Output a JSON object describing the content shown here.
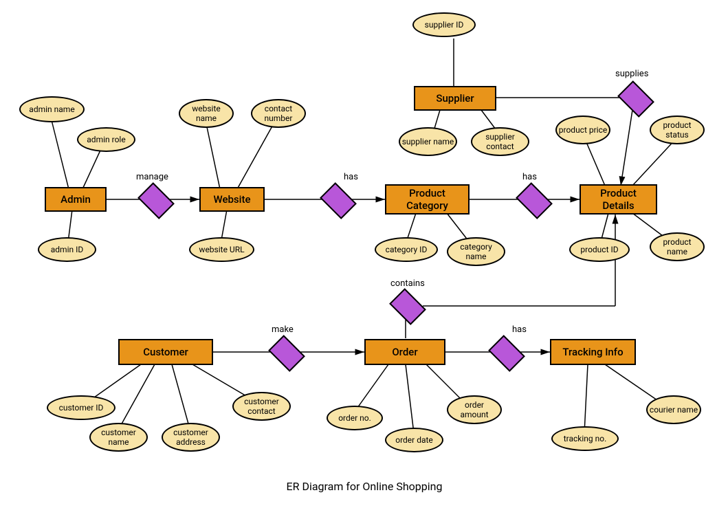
{
  "title": "ER Diagram for Online Shopping",
  "entities": {
    "admin": "Admin",
    "website": "Website",
    "productCategory": "Product Category",
    "productDetails": "Product Details",
    "supplier": "Supplier",
    "customer": "Customer",
    "order": "Order",
    "trackingInfo": "Tracking Info"
  },
  "attributes": {
    "adminName": "admin name",
    "adminRole": "admin role",
    "adminId": "admin ID",
    "websiteName": "website name",
    "contactNumber": "contact number",
    "websiteUrl": "website URL",
    "categoryId": "category ID",
    "categoryName": "category name",
    "supplierId": "supplier ID",
    "supplierName": "supplier name",
    "supplierContact": "supplier contact",
    "productPrice": "product price",
    "productStatus": "product status",
    "productId": "product ID",
    "productName": "product name",
    "customerId": "customer ID",
    "customerName": "customer name",
    "customerAddress": "customer address",
    "customerContact": "customer contact",
    "orderNo": "order no.",
    "orderDate": "order date",
    "orderAmount": "order amount",
    "trackingNo": "tracking no.",
    "courierName": "courier name"
  },
  "relationships": {
    "manage": "manage",
    "hasWebsiteCategory": "has",
    "hasCategoryDetails": "has",
    "supplies": "supplies",
    "make": "make",
    "contains": "contains",
    "hasOrderTracking": "has"
  }
}
